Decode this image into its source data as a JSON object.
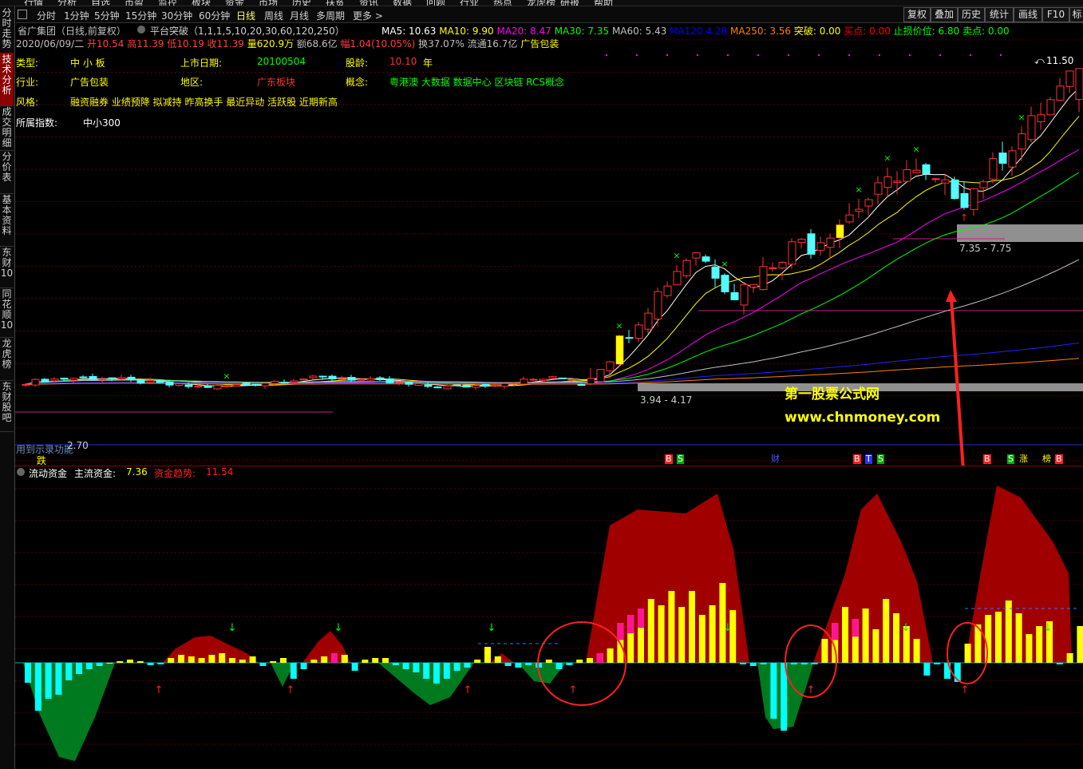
{
  "top_menu": [
    "行情",
    "分析",
    "自选",
    "市盈",
    "监控",
    "板块",
    "资金",
    "市场",
    "历史",
    "扶贫",
    "资讯",
    "数据",
    "问题",
    "行业",
    "热点",
    "龙虎榜",
    "研报",
    "帮助"
  ],
  "periods": [
    "分时",
    "1分钟",
    "5分钟",
    "15分钟",
    "30分钟",
    "60分钟",
    "日线",
    "周线",
    "月线",
    "多周期",
    "更多 >"
  ],
  "active_period": "日线",
  "toolbar": [
    "复权",
    "叠加",
    "历史",
    "统计",
    "画线",
    "F10",
    "标"
  ],
  "sidebar_tabs": [
    "分时走势",
    "技术分析",
    "成交明细",
    "分价表",
    "基本资料",
    "东财10",
    "同花顺10",
    "龙虎榜",
    "东财股吧"
  ],
  "active_sidebar": "技术分析",
  "stock": {
    "name": "省广集团（日线,前复权）",
    "indicator": "平台突破（1,1,1,5,10,20,30,60,120,250）",
    "ma": [
      {
        "label": "MA5:",
        "value": "10.63",
        "color": "#ffffff"
      },
      {
        "label": "MA10:",
        "value": "9.90",
        "color": "#ffff00"
      },
      {
        "label": "MA20:",
        "value": "8.47",
        "color": "#ff00ff"
      },
      {
        "label": "MA30:",
        "value": "7.35",
        "color": "#00ff00"
      },
      {
        "label": "MA60:",
        "value": "5.43",
        "color": "#c0c0c0"
      },
      {
        "label": "MA120",
        "value": "4.28",
        "color": "#0000ff"
      },
      {
        "label": "MA250:",
        "value": "3.56",
        "color": "#ff8000"
      }
    ],
    "signals": [
      {
        "label": "突破:",
        "value": "0.00",
        "color": "#ffff00"
      },
      {
        "label": "买点:",
        "value": "0.00",
        "color": "#ff0000"
      },
      {
        "label": "止损价位:",
        "value": "6.80",
        "color": "#00ff00"
      },
      {
        "label": "卖点:",
        "value": "0.00",
        "color": "#00ff00"
      }
    ],
    "quote_line": [
      {
        "text": "2020/06/09/二",
        "color": "#c0c0c0"
      },
      {
        "text": "开10.54",
        "color": "#ff4040"
      },
      {
        "text": "高11.39",
        "color": "#ff4040"
      },
      {
        "text": "低10.19",
        "color": "#ff4040"
      },
      {
        "text": "收11.39",
        "color": "#ff4040"
      },
      {
        "text": "量620.9万",
        "color": "#ffff00"
      },
      {
        "text": "额68.6亿",
        "color": "#c0c0c0"
      },
      {
        "text": "幅1.04(10.05%)",
        "color": "#ff4040"
      },
      {
        "text": "换37.07%",
        "color": "#c0c0c0"
      },
      {
        "text": "流通16.7亿",
        "color": "#c0c0c0"
      },
      {
        "text": "广告包装",
        "color": "#ffff00"
      }
    ]
  },
  "profile": {
    "type_label": "类型:",
    "type_value": "中 小 板",
    "listing_label": "上市日期:",
    "listing_value": "20100504",
    "age_label": "股龄:",
    "age_value": "10.10",
    "age_unit": "年",
    "industry_label": "行业:",
    "industry_value": "广告包装",
    "region_label": "地区:",
    "region_value": "广东板块",
    "concept_label": "概念:",
    "concept_value": "粤港澳 大数据 数据中心 区块链 RCS概念",
    "style_label": "风格:",
    "style_value": "融资融券 业绩预降 拟减持 昨高换手 最近异动 活跃股 近期新高",
    "index_label": "所属指数:",
    "index_value": "中小300"
  },
  "chart_annotations": {
    "high_price": "11.50",
    "band_low": "3.94 - 4.17",
    "band_high": "7.35 - 7.75",
    "watermark_cn": "第一股票公式网",
    "watermark_url": "www.chnmoney.com",
    "bottom_left": "用到示录功能",
    "bottom_left_num": "2.70",
    "event_label": "跌",
    "event_markers": [
      "B",
      "S",
      "财",
      "B",
      "T",
      "S",
      "B",
      "S",
      "涨",
      "榜",
      "B"
    ]
  },
  "sub_indicator": {
    "title": "流动资金",
    "main_label": "主流资金:",
    "main_value": "7.36",
    "trend_label": "资金趋势:",
    "trend_value": "11.54"
  },
  "colors": {
    "candle_up": "#ff3232",
    "candle_down": "#54ffff",
    "bar_yellow": "#ffff00",
    "bar_magenta": "#ff1493",
    "bar_cyan": "#00ffff",
    "area_red": "#a00000",
    "area_green": "#007a1f",
    "arrow_red": "#ff2020",
    "watermark": "#ffff00"
  }
}
